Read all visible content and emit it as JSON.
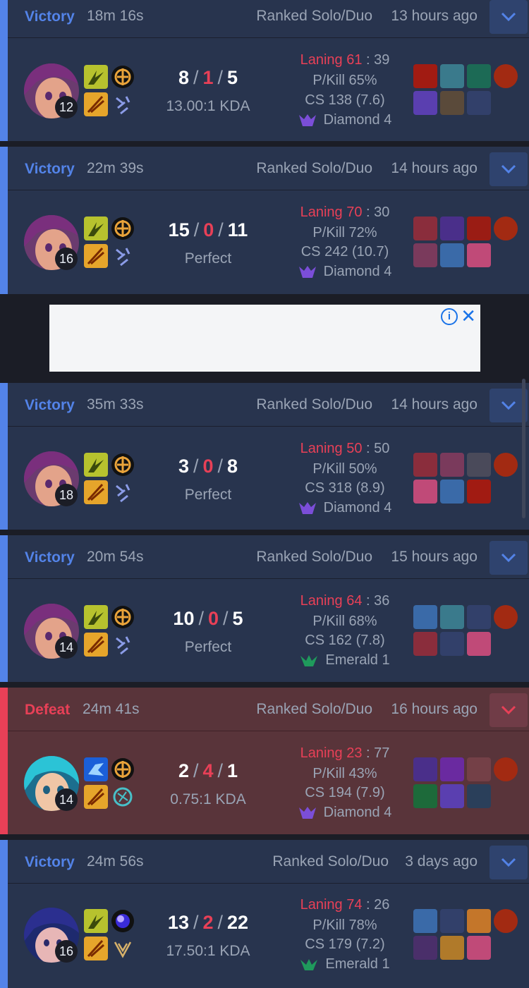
{
  "matches": [
    {
      "result": "Victory",
      "duration": "18m 16s",
      "queue": "Ranked Solo/Duo",
      "ago": "13 hours ago",
      "level": "12",
      "kills": "8",
      "deaths": "1",
      "assists": "5",
      "ratio": "13.00:1 KDA",
      "laning_label": "Laning 61",
      "laning_opp": ": 39",
      "pkill": "P/Kill 65%",
      "cs": "CS 138 (7.6)",
      "tier": "Diamond 4",
      "tier_icon": "diamond-icon"
    },
    {
      "result": "Victory",
      "duration": "22m 39s",
      "queue": "Ranked Solo/Duo",
      "ago": "14 hours ago",
      "level": "16",
      "kills": "15",
      "deaths": "0",
      "assists": "11",
      "ratio": "Perfect",
      "laning_label": "Laning 70",
      "laning_opp": ": 30",
      "pkill": "P/Kill 72%",
      "cs": "CS 242 (10.7)",
      "tier": "Diamond 4",
      "tier_icon": "diamond-icon"
    },
    {
      "result": "Victory",
      "duration": "35m 33s",
      "queue": "Ranked Solo/Duo",
      "ago": "14 hours ago",
      "level": "18",
      "kills": "3",
      "deaths": "0",
      "assists": "8",
      "ratio": "Perfect",
      "laning_label": "Laning 50",
      "laning_opp": ": 50",
      "pkill": "P/Kill 50%",
      "cs": "CS 318 (8.9)",
      "tier": "Diamond 4",
      "tier_icon": "diamond-icon"
    },
    {
      "result": "Victory",
      "duration": "20m 54s",
      "queue": "Ranked Solo/Duo",
      "ago": "15 hours ago",
      "level": "14",
      "kills": "10",
      "deaths": "0",
      "assists": "5",
      "ratio": "Perfect",
      "laning_label": "Laning 64",
      "laning_opp": ": 36",
      "pkill": "P/Kill 68%",
      "cs": "CS 162 (7.8)",
      "tier": "Emerald 1",
      "tier_icon": "emerald-icon"
    },
    {
      "result": "Defeat",
      "duration": "24m 41s",
      "queue": "Ranked Solo/Duo",
      "ago": "16 hours ago",
      "level": "14",
      "kills": "2",
      "deaths": "4",
      "assists": "1",
      "ratio": "0.75:1 KDA",
      "laning_label": "Laning 23",
      "laning_opp": ": 77",
      "pkill": "P/Kill 43%",
      "cs": "CS 194 (7.9)",
      "tier": "Diamond 4",
      "tier_icon": "diamond-icon"
    },
    {
      "result": "Victory",
      "duration": "24m 56s",
      "queue": "Ranked Solo/Duo",
      "ago": "3 days ago",
      "level": "16",
      "kills": "13",
      "deaths": "2",
      "assists": "22",
      "ratio": "17.50:1 KDA",
      "laning_label": "Laning 74",
      "laning_opp": ": 26",
      "pkill": "P/Kill 78%",
      "cs": "CS 179 (7.2)",
      "tier": "Emerald 1",
      "tier_icon": "emerald-icon"
    }
  ],
  "kda_separator": "/",
  "ad": {
    "info_glyph": "i",
    "close_glyph": "✕"
  },
  "colors": {
    "victory": "#5383e8",
    "defeat": "#e84057",
    "win_bg": "#28344e",
    "loss_bg": "#59343a"
  }
}
